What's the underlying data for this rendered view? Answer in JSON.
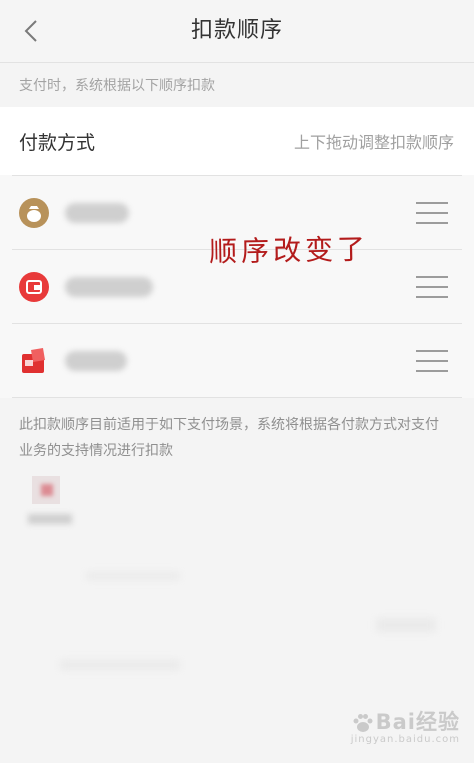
{
  "nav": {
    "title": "扣款顺序",
    "back_icon": "chevron-left-icon"
  },
  "hint": "支付时，系统根据以下顺序扣款",
  "section": {
    "label": "付款方式",
    "drag_hint": "上下拖动调整扣款顺序"
  },
  "payment_methods": [
    {
      "icon": "money-bag-icon",
      "icon_color": "#b8925a",
      "name_blurred": true
    },
    {
      "icon": "wallet-card-icon",
      "icon_color": "#e83a3a",
      "name_blurred": true
    },
    {
      "icon": "red-card-icon",
      "icon_color": "#e03030",
      "name_blurred": true
    }
  ],
  "annotation": "顺序改变了",
  "scene_description": "此扣款顺序目前适用于如下支付场景，系统将根据各付款方式对支付业务的支持情况进行扣款",
  "watermark": {
    "main": "Bai经验",
    "sub": "jingyan.baidu.com"
  },
  "colors": {
    "annotation": "#b31b1b",
    "background": "#f4f4f4",
    "text_secondary": "#a0a0a0"
  }
}
